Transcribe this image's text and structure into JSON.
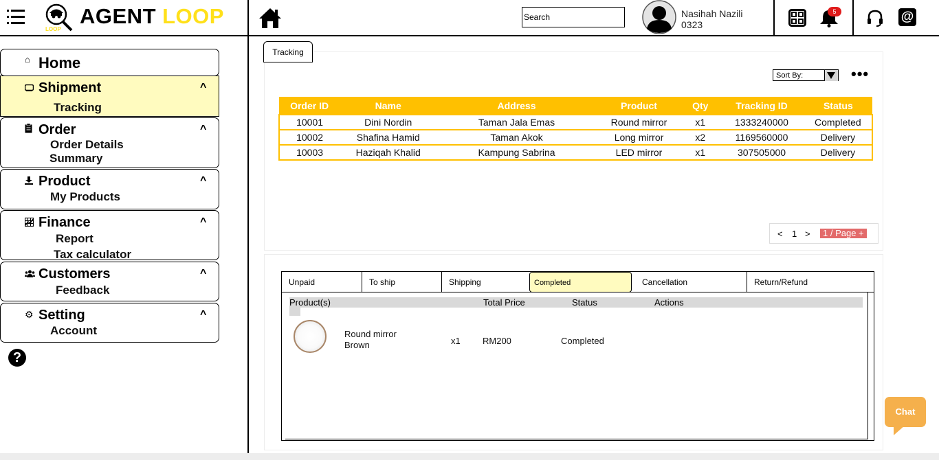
{
  "header": {
    "brand_part1": "AGENT",
    "brand_part2": "LOOP",
    "logo_caption": "LOOP",
    "search_placeholder": "Search",
    "user_name": "Nasihah Nazili",
    "user_id": "0323",
    "notification_count": "5",
    "at_symbol": "@"
  },
  "sidebar": {
    "help_symbol": "?",
    "items": [
      {
        "label": "Home",
        "icon": "home-icon",
        "caret": "",
        "subitems": []
      },
      {
        "label": "Shipment",
        "icon": "truck-icon",
        "caret": "^",
        "subitems": [
          "Tracking"
        ]
      },
      {
        "label": "Order",
        "icon": "clipboard-icon",
        "caret": "^",
        "subitems": [
          "Order Details",
          "Summary"
        ]
      },
      {
        "label": "Product",
        "icon": "download-icon",
        "caret": "^",
        "subitems": [
          "My Products"
        ]
      },
      {
        "label": "Finance",
        "icon": "chart-icon",
        "caret": "^",
        "subitems": [
          "Report",
          "Tax calculator"
        ]
      },
      {
        "label": "Customers",
        "icon": "users-icon",
        "caret": "^",
        "subitems": [
          "Feedback"
        ]
      },
      {
        "label": "Setting",
        "icon": "gear-icon",
        "caret": "^",
        "subitems": [
          "Account"
        ]
      }
    ]
  },
  "tracking": {
    "tab_label": "Tracking",
    "sort_label": "Sort By:",
    "more_label": "•••",
    "columns": [
      "Order ID",
      "Name",
      "Address",
      "Product",
      "Qty",
      "Tracking ID",
      "Status"
    ],
    "rows": [
      [
        "10001",
        "Dini Nordin",
        "Taman Jala Emas",
        "Round mirror",
        "x1",
        "1333240000",
        "Completed"
      ],
      [
        "10002",
        "Shafina Hamid",
        "Taman Akok",
        "Long mirror",
        "x2",
        "1169560000",
        "Delivery"
      ],
      [
        "10003",
        "Haziqah Khalid",
        "Kampung Sabrina",
        "LED mirror",
        "x1",
        "307505000",
        "Delivery"
      ]
    ],
    "pager": {
      "prev": "<",
      "page": "1",
      "next": ">",
      "per_page": "1 / Page +"
    },
    "header_color": "#ffc000"
  },
  "orders": {
    "tabs": [
      "Unpaid",
      "To ship",
      "Shipping",
      "Completed",
      "Cancellation",
      "Return/Refund"
    ],
    "selected_tab": "Completed",
    "columns": [
      "Product(s)",
      "Total Price",
      "Status",
      "Actions"
    ],
    "items": [
      {
        "name": "Round mirror",
        "variant": "Brown",
        "qty": "x1",
        "price": "RM200",
        "status": "Completed"
      }
    ]
  },
  "chat": {
    "label": "Chat",
    "color": "#f5b04c"
  }
}
